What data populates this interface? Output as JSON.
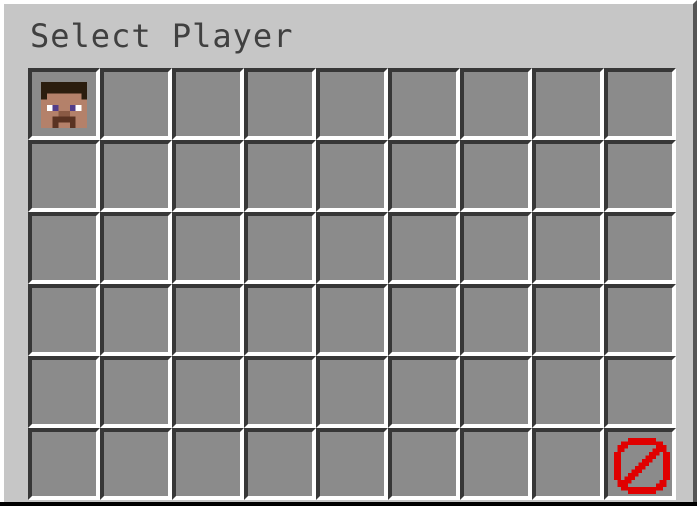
{
  "window": {
    "title": "Select Player"
  },
  "grid": {
    "columns": 9,
    "rows": 6,
    "items": [
      {
        "slot": 0,
        "icon": "player-head-icon"
      },
      {
        "slot": 53,
        "icon": "barrier-icon"
      }
    ]
  },
  "colors": {
    "panel_background": "#c6c6c6",
    "slot_background": "#8b8b8b",
    "slot_shadow": "#373737",
    "slot_highlight": "#ffffff",
    "title_text": "#404040",
    "barrier_red": "#e00000"
  }
}
